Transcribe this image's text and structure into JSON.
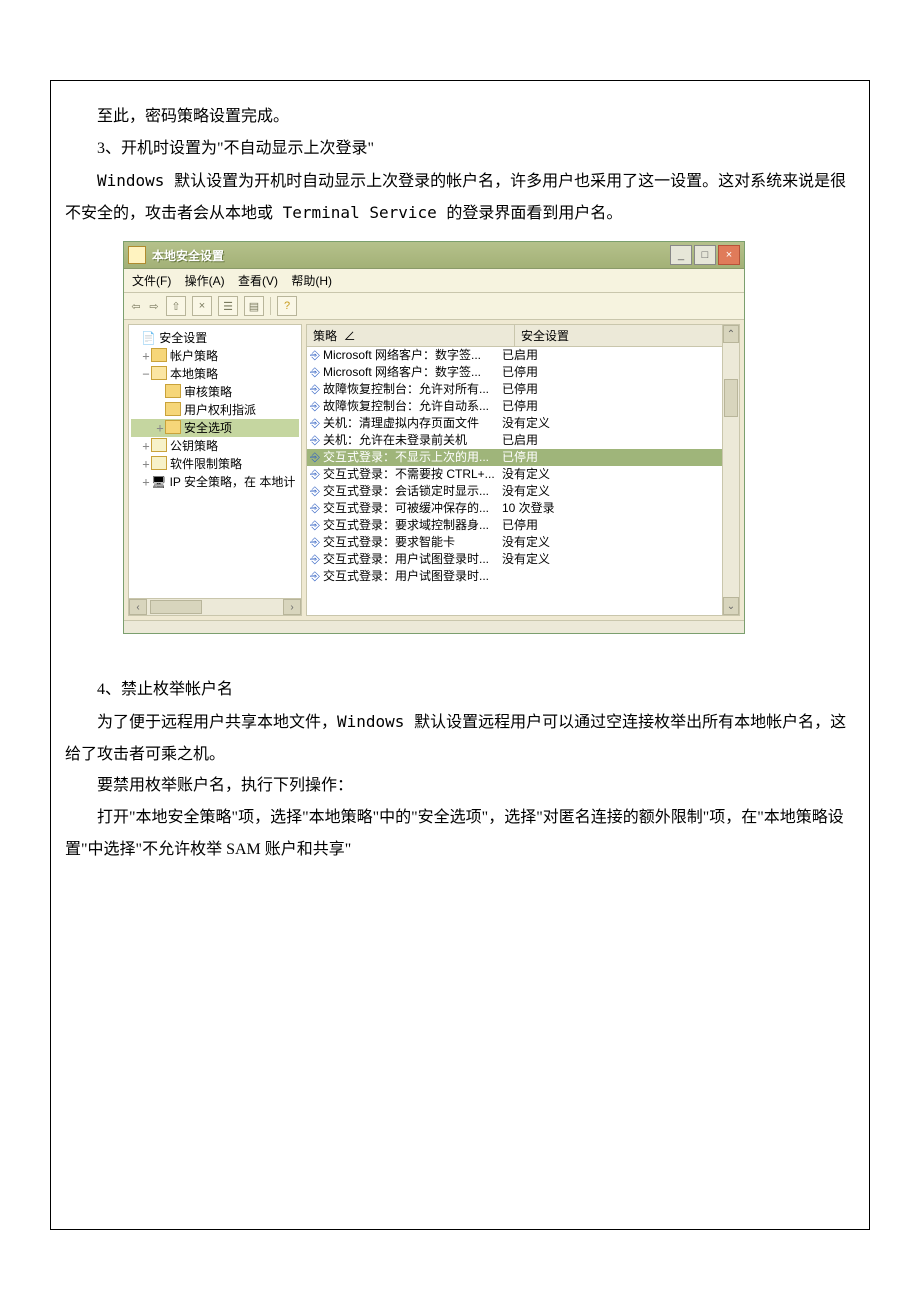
{
  "text": {
    "p1": "至此，密码策略设置完成。",
    "p2": "3、开机时设置为\"不自动显示上次登录\"",
    "p3": "Windows 默认设置为开机时自动显示上次登录的帐户名，许多用户也采用了这一设置。这对系统来说是很不安全的，攻击者会从本地或 Terminal Service 的登录界面看到用户名。",
    "p4": "4、禁止枚举帐户名",
    "p5": "为了便于远程用户共享本地文件，Windows 默认设置远程用户可以通过空连接枚举出所有本地帐户名，这给了攻击者可乘之机。",
    "p6": "要禁用枚举账户名，执行下列操作：",
    "p7": "打开\"本地安全策略\"项，选择\"本地策略\"中的\"安全选项\"，选择\"对匿名连接的额外限制\"项，在\"本地策略设置\"中选择\"不允许枚举 SAM 账户和共享\""
  },
  "win": {
    "title": "本地安全设置",
    "menu": {
      "file": "文件(F)",
      "action": "操作(A)",
      "view": "查看(V)",
      "help": "帮助(H)"
    },
    "tree": {
      "root": "安全设置",
      "n1": "帐户策略",
      "n2": "本地策略",
      "n2a": "审核策略",
      "n2b": "用户权利指派",
      "n2c": "安全选项",
      "n3": "公钥策略",
      "n4": "软件限制策略",
      "n5": "IP 安全策略，在 本地计"
    },
    "columns": {
      "c1": "策略",
      "c2": "安全设置"
    },
    "rows": [
      {
        "p": "Microsoft 网络客户：数字签...",
        "s": "已启用"
      },
      {
        "p": "Microsoft 网络客户：数字签...",
        "s": "已停用"
      },
      {
        "p": "故障恢复控制台：允许对所有...",
        "s": "已停用"
      },
      {
        "p": "故障恢复控制台：允许自动系...",
        "s": "已停用"
      },
      {
        "p": "关机：清理虚拟内存页面文件",
        "s": "没有定义"
      },
      {
        "p": "关机：允许在未登录前关机",
        "s": "已启用"
      },
      {
        "p": "交互式登录：不显示上次的用...",
        "s": "已停用",
        "sel": true
      },
      {
        "p": "交互式登录：不需要按 CTRL+...",
        "s": "没有定义"
      },
      {
        "p": "交互式登录：会话锁定时显示...",
        "s": "没有定义"
      },
      {
        "p": "交互式登录：可被缓冲保存的...",
        "s": "10 次登录"
      },
      {
        "p": "交互式登录：要求域控制器身...",
        "s": "已停用"
      },
      {
        "p": "交互式登录：要求智能卡",
        "s": "没有定义"
      },
      {
        "p": "交互式登录：用户试图登录时...",
        "s": "没有定义"
      },
      {
        "p": "交互式登录：用户试图登录时...",
        "s": ""
      }
    ]
  }
}
